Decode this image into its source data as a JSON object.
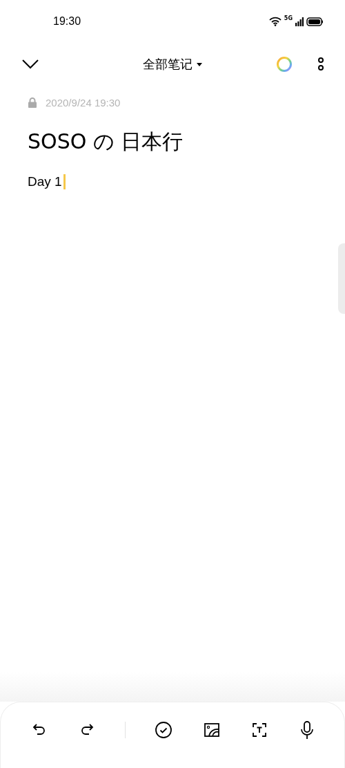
{
  "status_bar": {
    "time": "19:30",
    "network": "5G"
  },
  "header": {
    "title": "全部笔记"
  },
  "note": {
    "locked": true,
    "date": "2020/9/24 19:30",
    "title": "SOSO の 日本行",
    "body": "Day 1"
  },
  "toolbar": [
    {
      "kind": "undo"
    },
    {
      "kind": "redo"
    },
    {
      "kind": "divider"
    },
    {
      "kind": "checklist"
    },
    {
      "kind": "image"
    },
    {
      "kind": "text-scan"
    },
    {
      "kind": "mic"
    }
  ]
}
